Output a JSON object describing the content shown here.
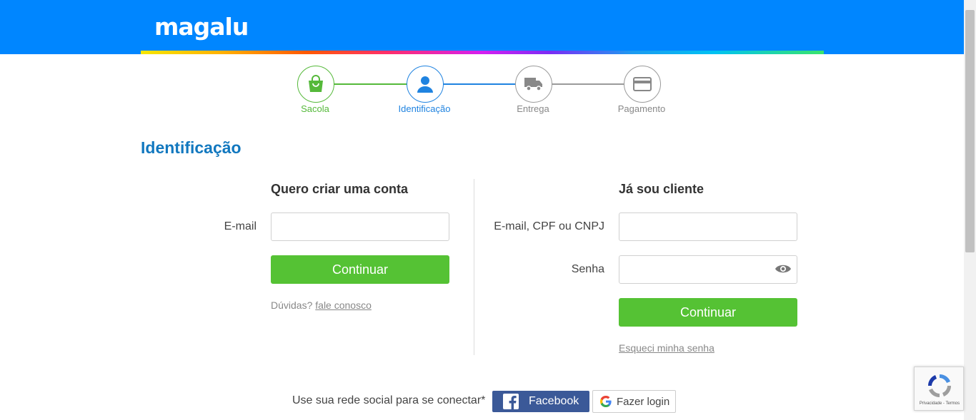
{
  "header": {
    "logo": "magalu"
  },
  "steps": [
    {
      "label": "Sacola",
      "icon": "shopping-bag-icon",
      "state": "done",
      "color": "#55b93a"
    },
    {
      "label": "Identificação",
      "icon": "user-icon",
      "state": "current",
      "color": "#1f83e0"
    },
    {
      "label": "Entrega",
      "icon": "truck-icon",
      "state": "pending",
      "color": "#888888"
    },
    {
      "label": "Pagamento",
      "icon": "credit-card-icon",
      "state": "pending",
      "color": "#888888"
    }
  ],
  "page_title": "Identificação",
  "create_account": {
    "title": "Quero criar uma conta",
    "email_label": "E-mail",
    "email_value": "",
    "continue_label": "Continuar",
    "help_prefix": "Dúvidas?",
    "help_link": "fale conosco"
  },
  "existing_client": {
    "title": "Já sou cliente",
    "login_label": "E-mail, CPF ou CNPJ",
    "login_value": "",
    "password_label": "Senha",
    "password_value": "",
    "continue_label": "Continuar",
    "forgot_link": "Esqueci minha senha"
  },
  "social": {
    "label": "Use sua rede social para se conectar*",
    "facebook_label": "Facebook",
    "google_label": "Fazer login"
  },
  "recaptcha": {
    "text": "Privacidade - Termos"
  },
  "colors": {
    "brand": "#0086ff",
    "green": "#55c234",
    "title_blue": "#1278bf",
    "facebook": "#3b5998"
  }
}
